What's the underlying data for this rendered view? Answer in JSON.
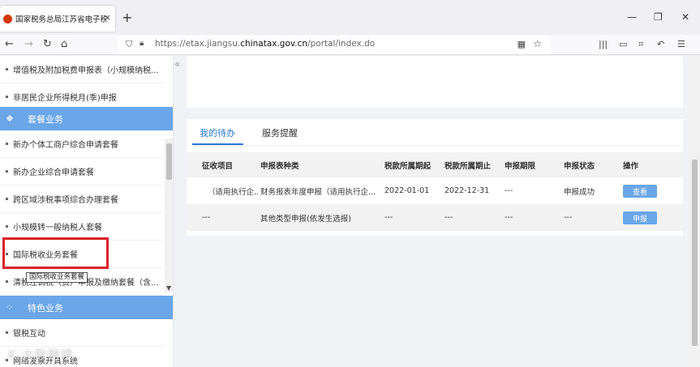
{
  "browser": {
    "tab_title": "国家税务总局江苏省电子税务局",
    "tab_close": "×",
    "new_tab": "+",
    "url_prefix": "https://etax.jiangsu.",
    "url_domain": "chinatax.gov.cn",
    "url_path": "/portal/index.do"
  },
  "sidebar": {
    "rows_top": [
      {
        "label": "增值税及附加税费申报表（小规模纳税..."
      },
      {
        "label": "非居民企业所得税月(季)申报"
      }
    ],
    "group1": {
      "label": "套餐业务",
      "icon": "layers-icon"
    },
    "group1_items": [
      {
        "label": "新办个体工商户综合申请套餐"
      },
      {
        "label": "新办企业综合申请套餐"
      },
      {
        "label": "跨区域涉税事项综合办理套餐"
      },
      {
        "label": "小规模转一般纳税人套餐"
      },
      {
        "label": "国际税收业务套餐"
      },
      {
        "label": "清税注销税（费）申报及缴纳套餐（含..."
      }
    ],
    "group2": {
      "label": "特色业务",
      "icon": "grid-icon"
    },
    "group2_items": [
      {
        "label": "银税互动"
      },
      {
        "label": "网络发票开具系统"
      }
    ],
    "tooltip": "国际税收业务套餐",
    "watermark": "K 大数跨境"
  },
  "main": {
    "tabs": [
      {
        "label": "我的待办"
      },
      {
        "label": "服务提醒"
      }
    ],
    "table": {
      "headers": [
        "征收项目",
        "申报表种类",
        "税款所属期起",
        "税款所属期止",
        "申报期限",
        "申报状态",
        "操作"
      ],
      "rows": [
        {
          "c0": "（适用执行企...",
          "c1": "财务报表年度申报（适用执行企...",
          "c2": "2022-01-01",
          "c3": "2022-12-31",
          "c4": "---",
          "c5": "申报成功",
          "action": "查看"
        },
        {
          "c0": "---",
          "c1": "其他类型申报(依发生选报)",
          "c2": "---",
          "c3": "---",
          "c4": "---",
          "c5": "---",
          "action": "申报"
        }
      ]
    }
  },
  "colors": {
    "accent": "#2a78d5",
    "sidebar_group": "#6aa6e8",
    "highlight": "#d9232a"
  }
}
